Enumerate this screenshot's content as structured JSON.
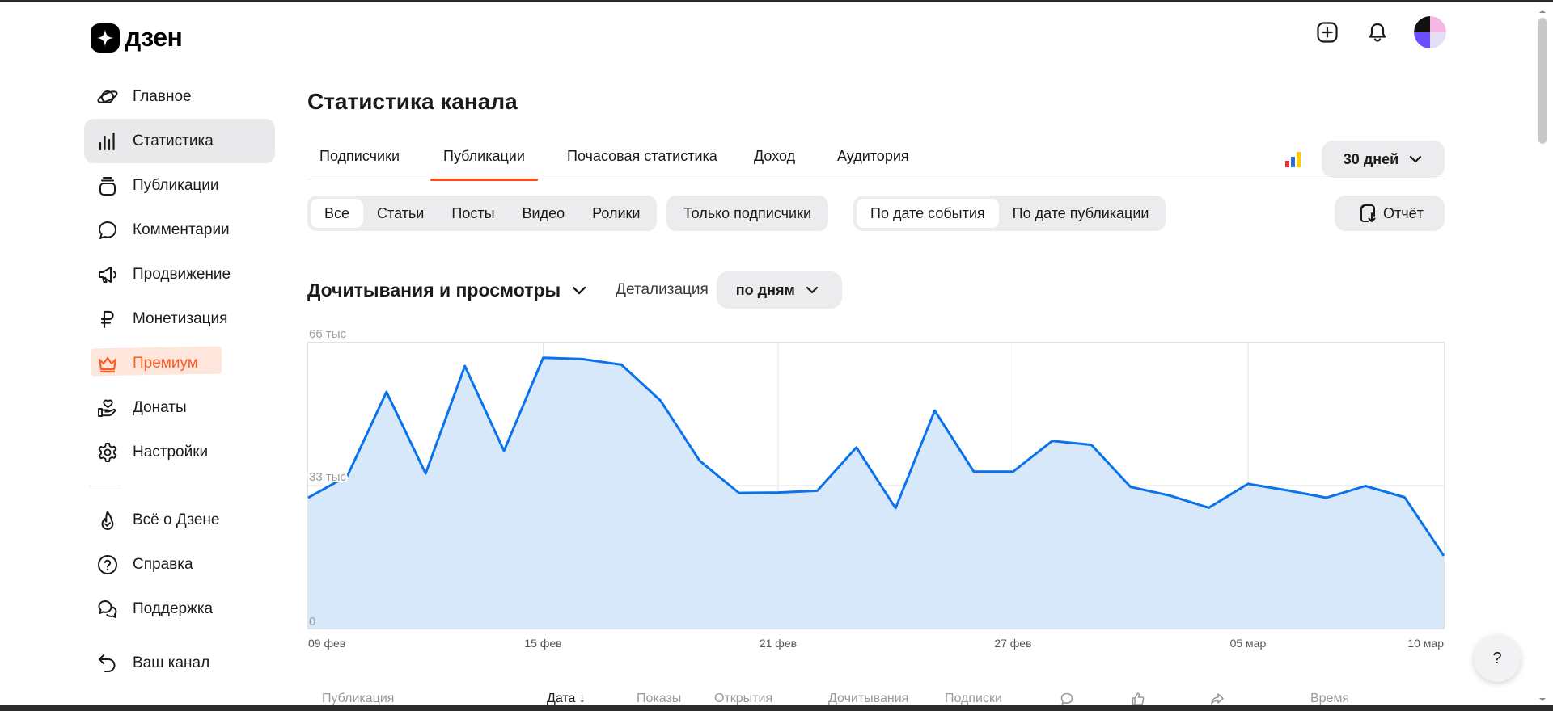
{
  "app": {
    "logo_text": "дзен"
  },
  "sidebar": {
    "items": [
      {
        "label": "Главное",
        "icon": "planet-icon"
      },
      {
        "label": "Статистика",
        "icon": "bar-stats-icon"
      },
      {
        "label": "Публикации",
        "icon": "stack-icon"
      },
      {
        "label": "Комментарии",
        "icon": "comment-icon"
      },
      {
        "label": "Продвижение",
        "icon": "megaphone-icon"
      },
      {
        "label": "Монетизация",
        "icon": "ruble-icon"
      },
      {
        "label": "Премиум",
        "icon": "crown-icon"
      },
      {
        "label": "Донаты",
        "icon": "donate-hand-icon"
      },
      {
        "label": "Настройки",
        "icon": "gear-icon"
      }
    ],
    "secondary": [
      {
        "label": "Всё о Дзене",
        "icon": "flame-icon"
      },
      {
        "label": "Справка",
        "icon": "help-circle-icon"
      },
      {
        "label": "Поддержка",
        "icon": "chat-bubbles-icon"
      }
    ],
    "channel": {
      "label": "Ваш канал",
      "icon": "back-arrow-icon"
    },
    "active_index": 1
  },
  "page": {
    "title": "Статистика канала"
  },
  "tabs": [
    {
      "label": "Подписчики"
    },
    {
      "label": "Публикации"
    },
    {
      "label": "Почасовая статистика"
    },
    {
      "label": "Доход"
    },
    {
      "label": "Аудитория"
    }
  ],
  "active_tab": 1,
  "period": {
    "label": "30 дней"
  },
  "filters": {
    "content_types": [
      "Все",
      "Статьи",
      "Посты",
      "Видео",
      "Ролики"
    ],
    "subscribers_only": "Только подписчики",
    "date_mode": [
      "По дате события",
      "По дате публикации"
    ]
  },
  "report_button": {
    "label": "Отчёт"
  },
  "metric": {
    "title": "Дочитывания и просмотры",
    "detail_label": "Детализация",
    "detail_value": "по дням"
  },
  "chart_data": {
    "type": "area",
    "ylim": [
      0,
      66000
    ],
    "y_tick_labels": [
      "66 тыс",
      "33 тыс",
      "0"
    ],
    "x_tick_labels": [
      "09 фев",
      "15 фев",
      "21 фев",
      "27 фев",
      "05 мар",
      "10 мар"
    ],
    "x": [
      "09 фев",
      "10 фев",
      "11 фев",
      "12 фев",
      "13 фев",
      "14 фев",
      "15 фев",
      "16 фев",
      "17 фев",
      "18 фев",
      "19 фев",
      "20 фев",
      "21 фев",
      "22 фев",
      "23 фев",
      "24 фев",
      "25 фев",
      "26 фев",
      "27 фев",
      "28 фев",
      "01 мар",
      "02 мар",
      "03 мар",
      "04 мар",
      "05 мар",
      "06 мар",
      "07 мар",
      "08 мар",
      "09 мар",
      "10 мар"
    ],
    "series": [
      {
        "values": [
          30200,
          35200,
          54600,
          35800,
          60600,
          41000,
          62500,
          62200,
          60900,
          52600,
          38700,
          31300,
          31400,
          31800,
          41800,
          27800,
          50300,
          36200,
          36200,
          43300,
          42400,
          32700,
          30700,
          27900,
          33400,
          31900,
          30200,
          32900,
          30300,
          16800
        ]
      }
    ],
    "colors": {
      "line": "#0a73eb",
      "fill": "#d7e8fb",
      "grid": "#e2e2e2"
    }
  },
  "table_headers": [
    "Публикация",
    "Дата ↓",
    "Показы",
    "Открытия",
    "Дочитывания",
    "Подписки",
    "comment-icon",
    "like-icon",
    "share-icon",
    "Время"
  ],
  "help_button": {
    "label": "?"
  }
}
